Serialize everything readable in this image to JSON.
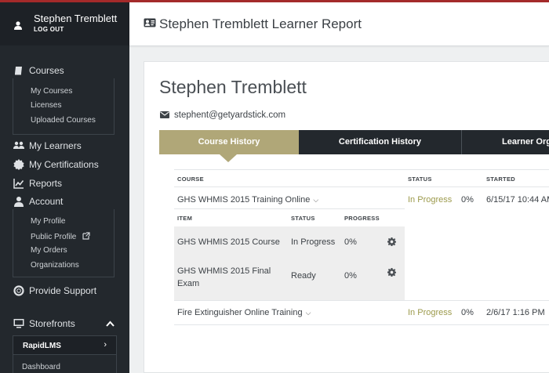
{
  "user": {
    "name": "Stephen Tremblett",
    "logout": "LOG OUT"
  },
  "sidebar": {
    "courses": {
      "label": "Courses",
      "items": [
        "My Courses",
        "Licenses",
        "Uploaded Courses"
      ]
    },
    "my_learners": "My Learners",
    "my_certifications": "My Certifications",
    "reports": "Reports",
    "account": {
      "label": "Account",
      "items": [
        "My Profile",
        "Public Profile",
        "My Orders",
        "Organizations"
      ]
    },
    "provide_support": "Provide Support",
    "storefronts": {
      "label": "Storefronts",
      "selected": "RapidLMS",
      "items": [
        "Dashboard"
      ]
    }
  },
  "header": {
    "title": "Stephen Tremblett Learner Report"
  },
  "learner": {
    "name": "Stephen Tremblett",
    "email": "stephent@getyardstick.com"
  },
  "tabs": [
    "Course History",
    "Certification History",
    "Learner Org"
  ],
  "table": {
    "headers": {
      "course": "COURSE",
      "status": "STATUS",
      "started": "STARTED"
    },
    "rows": [
      {
        "course": "GHS WHMIS 2015 Training Online",
        "status": "In Progress",
        "progress": "0%",
        "started": "6/15/17 10:44 AM"
      },
      {
        "course": "Fire Extinguisher Online Training",
        "status": "In Progress",
        "progress": "0%",
        "started": "2/6/17 1:16 PM"
      }
    ]
  },
  "nested": {
    "headers": {
      "item": "ITEM",
      "status": "STATUS",
      "progress": "PROGRESS"
    },
    "rows": [
      {
        "item": "GHS WHMIS 2015 Course",
        "status": "In Progress",
        "progress": "0%"
      },
      {
        "item_line1": "GHS WHMIS 2015 Final",
        "item_line2": "Exam",
        "status": "Ready",
        "progress": "0%"
      }
    ]
  },
  "colors": {
    "accent": "#b0a778",
    "sidebar": "#23282d",
    "status_green": "#9c9a4c",
    "top_bar": "#a42a2a"
  }
}
